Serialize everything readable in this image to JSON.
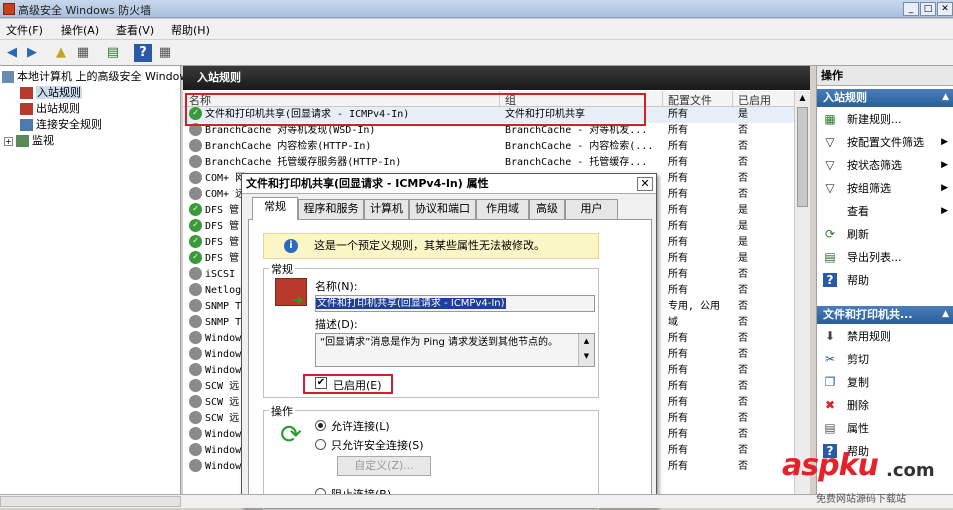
{
  "window": {
    "title": "高级安全 Windows 防火墙",
    "min": "_",
    "max": "□",
    "close": "✕"
  },
  "menu": [
    "文件(F)",
    "操作(A)",
    "查看(V)",
    "帮助(H)"
  ],
  "tree": {
    "root": "本地计算机 上的高级安全 Windows 防火墙",
    "items": [
      "入站规则",
      "出站规则",
      "连接安全规则",
      "监视"
    ]
  },
  "panel": {
    "title": "入站规则"
  },
  "columns": {
    "name": "名称",
    "group": "组",
    "profile": "配置文件",
    "enabled": "已启用"
  },
  "rules": [
    {
      "name": "文件和打印机共享(回显请求 - ICMPv4-In)",
      "group": "文件和打印机共享",
      "profile": "所有",
      "enabled": "是",
      "status": "ok"
    },
    {
      "name": "BranchCache 对等机发现(WSD-In)",
      "group": "BranchCache - 对等机发...",
      "profile": "所有",
      "enabled": "否",
      "status": "no"
    },
    {
      "name": "BranchCache 内容检索(HTTP-In)",
      "group": "BranchCache - 内容检索(...",
      "profile": "所有",
      "enabled": "否",
      "status": "no"
    },
    {
      "name": "BranchCache 托管缓存服务器(HTTP-In)",
      "group": "BranchCache - 托管缓存...",
      "profile": "所有",
      "enabled": "否",
      "status": "no"
    },
    {
      "name": "COM+ 网",
      "group": "",
      "profile": "所有",
      "enabled": "否",
      "status": "no"
    },
    {
      "name": "COM+ 远",
      "group": "",
      "profile": "所有",
      "enabled": "否",
      "status": "no"
    },
    {
      "name": "DFS 管",
      "group": "",
      "profile": "所有",
      "enabled": "是",
      "status": "ok"
    },
    {
      "name": "DFS 管",
      "group": "",
      "profile": "所有",
      "enabled": "是",
      "status": "ok"
    },
    {
      "name": "DFS 管",
      "group": "",
      "profile": "所有",
      "enabled": "是",
      "status": "ok"
    },
    {
      "name": "DFS 管",
      "group": "",
      "profile": "所有",
      "enabled": "是",
      "status": "ok"
    },
    {
      "name": "iSCSI",
      "group": "",
      "profile": "所有",
      "enabled": "否",
      "status": "no"
    },
    {
      "name": "Netlog",
      "group": "",
      "profile": "所有",
      "enabled": "否",
      "status": "no"
    },
    {
      "name": "SNMP T",
      "group": "",
      "profile": "专用, 公用",
      "enabled": "否",
      "status": "no"
    },
    {
      "name": "SNMP T",
      "group": "",
      "profile": "域",
      "enabled": "否",
      "status": "no"
    },
    {
      "name": "Window",
      "group": "",
      "profile": "所有",
      "enabled": "否",
      "status": "no"
    },
    {
      "name": "Window",
      "group": "",
      "profile": "所有",
      "enabled": "否",
      "status": "no"
    },
    {
      "name": "Window",
      "group": "",
      "profile": "所有",
      "enabled": "否",
      "status": "no"
    },
    {
      "name": "SCW 远",
      "group": "",
      "profile": "所有",
      "enabled": "否",
      "status": "no"
    },
    {
      "name": "SCW 远",
      "group": "",
      "profile": "所有",
      "enabled": "否",
      "status": "no"
    },
    {
      "name": "SCW 远",
      "group": "",
      "profile": "所有",
      "enabled": "否",
      "status": "no"
    },
    {
      "name": "Window",
      "group": "",
      "profile": "所有",
      "enabled": "否",
      "status": "no"
    },
    {
      "name": "Window",
      "group": "",
      "profile": "所有",
      "enabled": "否",
      "status": "no"
    },
    {
      "name": "Window",
      "group": "",
      "profile": "所有",
      "enabled": "否",
      "status": "no"
    }
  ],
  "actions": {
    "header1": "操作",
    "section1": "入站规则",
    "items1": [
      {
        "label": "新建规则...",
        "icon": "new-rule-icon",
        "glyph": "▦",
        "color": "#2a7a2a",
        "sub": false
      },
      {
        "label": "按配置文件筛选",
        "icon": "filter-icon",
        "glyph": "▽",
        "color": "#333",
        "sub": true
      },
      {
        "label": "按状态筛选",
        "icon": "filter-icon",
        "glyph": "▽",
        "color": "#333",
        "sub": true
      },
      {
        "label": "按组筛选",
        "icon": "filter-icon",
        "glyph": "▽",
        "color": "#333",
        "sub": true
      },
      {
        "label": "查看",
        "icon": "view-icon",
        "glyph": "",
        "color": "#333",
        "sub": true
      },
      {
        "label": "刷新",
        "icon": "refresh-icon",
        "glyph": "⟳",
        "color": "#2a7a2a",
        "sub": false
      },
      {
        "label": "导出列表...",
        "icon": "export-icon",
        "glyph": "▤",
        "color": "#2a6a2a",
        "sub": false
      },
      {
        "label": "帮助",
        "icon": "help-icon",
        "glyph": "?",
        "color": "#fff",
        "sub": false
      }
    ],
    "section2": "文件和打印机共...",
    "items2": [
      {
        "label": "禁用规则",
        "icon": "disable-icon",
        "glyph": "⬇",
        "color": "#444"
      },
      {
        "label": "剪切",
        "icon": "cut-icon",
        "glyph": "✂",
        "color": "#2a5a9a"
      },
      {
        "label": "复制",
        "icon": "copy-icon",
        "glyph": "❐",
        "color": "#2a5a9a"
      },
      {
        "label": "删除",
        "icon": "delete-icon",
        "glyph": "✖",
        "color": "#d22"
      },
      {
        "label": "属性",
        "icon": "properties-icon",
        "glyph": "▤",
        "color": "#555"
      },
      {
        "label": "帮助",
        "icon": "help-icon",
        "glyph": "?",
        "color": "#fff"
      }
    ]
  },
  "dialog": {
    "title": "文件和打印机共享(回显请求 - ICMPv4-In) 属性",
    "close": "✕",
    "tabs": [
      "常规",
      "程序和服务",
      "计算机",
      "协议和端口",
      "作用域",
      "高级",
      "用户"
    ],
    "info": "这是一个预定义规则，其某些属性无法被修改。",
    "general_group": "常规",
    "name_label": "名称(N):",
    "name_value": "文件和打印机共享(回显请求 - ICMPv4-In)",
    "desc_label": "描述(D):",
    "desc_value": "“回显请求”消息是作为 Ping 请求发送到其他节点的。",
    "enabled_label": "已启用(E)",
    "enabled_checked": true,
    "action_group": "操作",
    "allow": "允许连接(L)",
    "allow_secure": "只允许安全连接(S)",
    "customize": "自定义(Z)...",
    "block": "阻止连接(B)"
  },
  "watermark": {
    "brand": "aspku",
    "tld": ".com",
    "sub": "免费网站源码下载站"
  }
}
